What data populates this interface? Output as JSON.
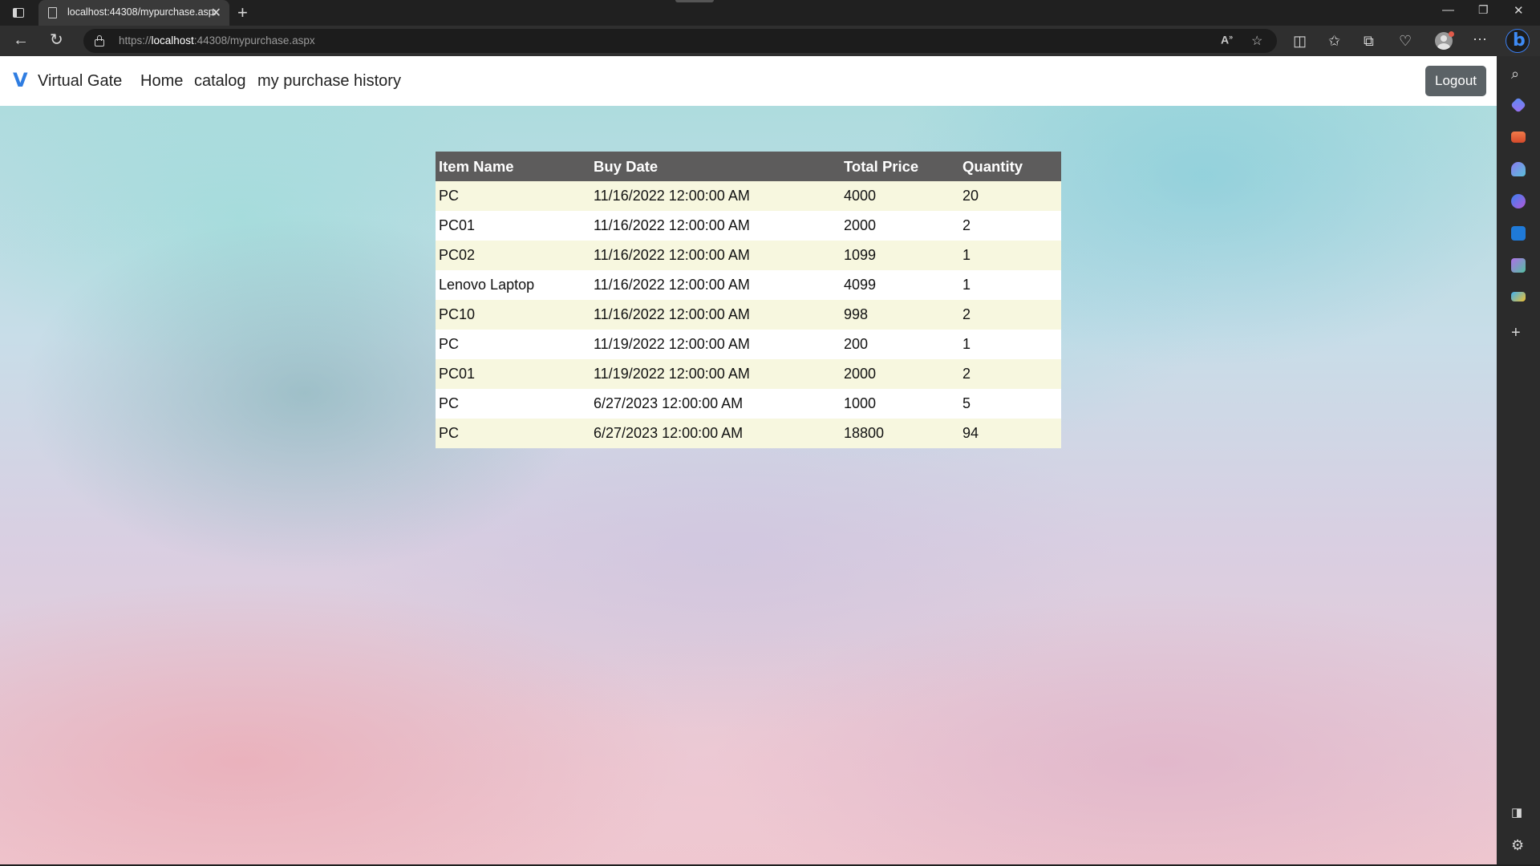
{
  "browser": {
    "tab_title": "localhost:44308/mypurchase.aspx",
    "url_scheme": "https://",
    "url_host": "localhost",
    "url_rest": ":44308/mypurchase.aspx"
  },
  "navbar": {
    "brand_logo": "V",
    "brand_name": "Virtual Gate",
    "links": [
      "Home",
      "catalog",
      "my purchase history"
    ],
    "logout_label": "Logout"
  },
  "table": {
    "headers": [
      "Item Name",
      "Buy Date",
      "Total Price",
      "Quantity"
    ],
    "rows": [
      [
        "PC",
        "11/16/2022 12:00:00 AM",
        "4000",
        "20"
      ],
      [
        "PC01",
        "11/16/2022 12:00:00 AM",
        "2000",
        "2"
      ],
      [
        "PC02",
        "11/16/2022 12:00:00 AM",
        "1099",
        "1"
      ],
      [
        "Lenovo Laptop",
        "11/16/2022 12:00:00 AM",
        "4099",
        "1"
      ],
      [
        "PC10",
        "11/16/2022 12:00:00 AM",
        "998",
        "2"
      ],
      [
        "PC",
        "11/19/2022 12:00:00 AM",
        "200",
        "1"
      ],
      [
        "PC01",
        "11/19/2022 12:00:00 AM",
        "2000",
        "2"
      ],
      [
        "PC",
        "6/27/2023 12:00:00 AM",
        "1000",
        "5"
      ],
      [
        "PC",
        "6/27/2023 12:00:00 AM",
        "18800",
        "94"
      ]
    ]
  },
  "colors": {
    "header_bg": "#5d5c5c",
    "odd_row_bg": "#f7f7df",
    "even_row_bg": "#ffffff",
    "brand_accent": "#2f7de1",
    "logout_bg": "#5b6266"
  },
  "icons": {
    "toolbar": [
      "back-icon",
      "refresh-icon",
      "lock-icon",
      "read-aloud-icon",
      "favorite-star-icon",
      "split-screen-icon",
      "favorites-icon",
      "collections-icon",
      "browser-essentials-icon",
      "profile-icon",
      "more-icon",
      "bing-icon"
    ],
    "sidebar": [
      "search-icon",
      "shopping-tag-icon",
      "tools-icon",
      "games-icon",
      "copilot-icon",
      "outlook-icon",
      "drop-icon",
      "designer-icon",
      "add-icon",
      "sidebar-toggle-icon",
      "settings-icon"
    ]
  }
}
